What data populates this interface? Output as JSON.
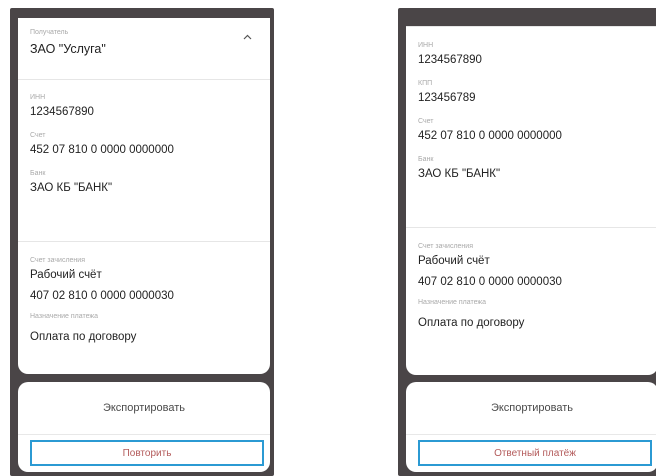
{
  "left_screen": {
    "recipient_label": "Получатель",
    "recipient_value": "ЗАО \"Услуга\"",
    "inn_label": "ИНН",
    "inn_value": "1234567890",
    "account_label": "Счет",
    "account_value": "452 07 810 0 0000 0000000",
    "bank_label": "Банк",
    "bank_value": "ЗАО КБ \"БАНК\"",
    "credit_account_label": "Счет зачисления",
    "credit_account_name": "Рабочий счёт",
    "credit_account_number": "407 02 810 0 0000 0000030",
    "purpose_label": "Назначение платежа",
    "purpose_value": "Оплата по договору",
    "export_label": "Экспортировать",
    "repeat_label": "Повторить"
  },
  "right_screen": {
    "inn_label": "ИНН",
    "inn_value": "1234567890",
    "kpp_label": "КПП",
    "kpp_value": "123456789",
    "account_label": "Счет",
    "account_value": "452 07 810 0 0000 0000000",
    "bank_label": "Банк",
    "bank_value": "ЗАО КБ \"БАНК\"",
    "credit_account_label": "Счет зачисления",
    "credit_account_name": "Рабочий счёт",
    "credit_account_number": "407 02 810 0 0000 0000030",
    "purpose_label": "Назначение платежа",
    "purpose_value": "Оплата по договору",
    "export_label": "Экспортировать",
    "reply_label": "Ответный платёж"
  },
  "colors": {
    "frame": "#4a4547",
    "highlight_border": "#2b9ad3",
    "button_text": "#b35a5a"
  },
  "icons": {
    "collapse": "chevron-up-icon"
  }
}
